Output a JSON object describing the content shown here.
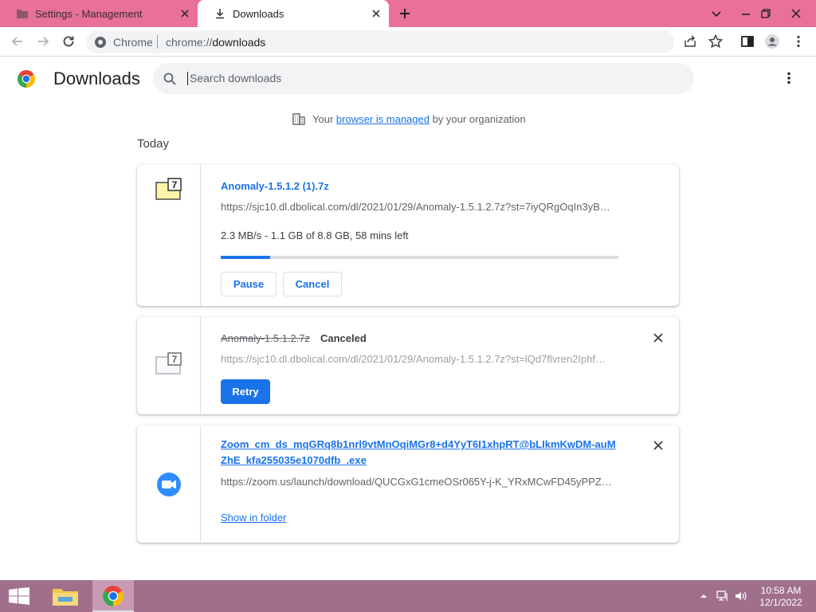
{
  "tabs": [
    {
      "title": "Settings - Management"
    },
    {
      "title": "Downloads"
    }
  ],
  "omnibox": {
    "site_chip": "Chrome",
    "url_scheme": "chrome://",
    "url_path": "downloads"
  },
  "page": {
    "title": "Downloads"
  },
  "search": {
    "placeholder": "Search downloads"
  },
  "managed": {
    "prefix": "Your",
    "link": "browser is managed",
    "suffix": "by your organization"
  },
  "section": {
    "date": "Today"
  },
  "downloads": [
    {
      "name": "Anomaly-1.5.1.2 (1).7z",
      "url": "https://sjc10.dl.dbolical.com/dl/2021/01/29/Anomaly-1.5.1.2.7z?st=7iyQRgOqIn3yB…",
      "description": "2.3 MB/s - 1.1 GB of 8.8 GB, 58 mins left",
      "progress_fraction": 0.125,
      "pause_label": "Pause",
      "cancel_label": "Cancel"
    },
    {
      "name": "Anomaly-1.5.1.2.7z",
      "state": "Canceled",
      "url": "https://sjc10.dl.dbolical.com/dl/2021/01/29/Anomaly-1.5.1.2.7z?st=lQd7flvren2Iphf…",
      "retry_label": "Retry"
    },
    {
      "name": "Zoom_cm_ds_mqGRq8b1nrl9vtMnOqiMGr8+d4YyT6I1xhpRT@bLIkmKwDM-auMZhE_kfa255035e1070dfb_.exe",
      "url": "https://zoom.us/launch/download/QUCGxG1cmeOSr065Y-j-K_YRxMCwFD45yPPZQi…",
      "show_in_folder_label": "Show in folder"
    }
  ],
  "clock": {
    "time": "10:58 AM",
    "date": "12/1/2022"
  },
  "colors": {
    "tab_strip": "#e8709a",
    "accent": "#1a73e8",
    "taskbar": "#a06f8b"
  }
}
